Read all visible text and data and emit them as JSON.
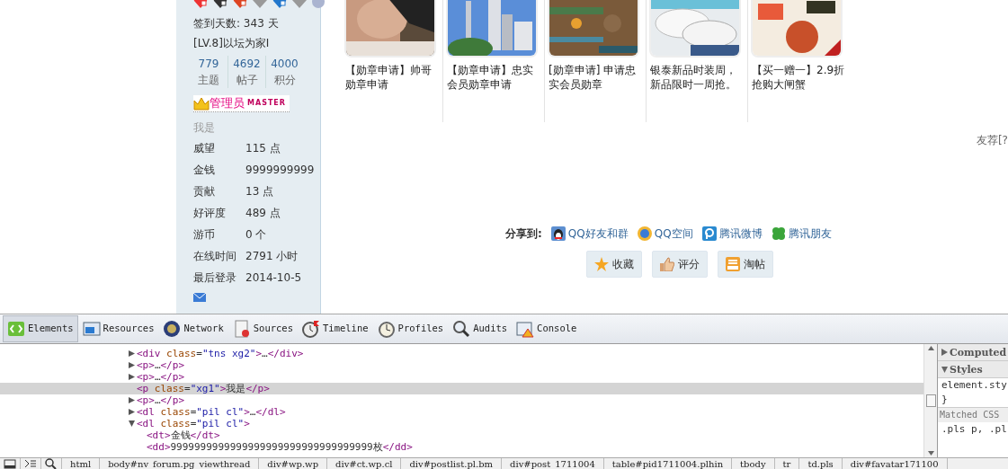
{
  "profile": {
    "checkin": "签到天数: 343 天",
    "level": "[LV.8]以坛为家I",
    "stats": [
      {
        "value": "779",
        "label": "主题"
      },
      {
        "value": "4692",
        "label": "帖子"
      },
      {
        "value": "4000",
        "label": "积分"
      }
    ],
    "group_badge": "管理员",
    "group_tag": "MASTER",
    "custom_title": "我是",
    "fields": [
      {
        "label": "威望",
        "value": "115 点"
      },
      {
        "label": "金钱",
        "value": "9999999999"
      },
      {
        "label": "贡献",
        "value": "13 点"
      },
      {
        "label": "好评度",
        "value": "489 点"
      },
      {
        "label": "游币",
        "value": "0 个"
      },
      {
        "label": "在线时间",
        "value": "2791 小时"
      },
      {
        "label": "最后登录",
        "value": "2014-10-5"
      }
    ]
  },
  "posts": [
    {
      "title": "【勋章申请】帅哥勋章申请"
    },
    {
      "title": "【勋章申请】忠实会员勋章申请"
    },
    {
      "title": "[勋章申请] 申请忠实会员勋章"
    },
    {
      "title": "银泰新品时装周，新品限时一周抢。"
    },
    {
      "title": "【买一赠一】2.9折抢购大闸蟹"
    }
  ],
  "side_note": "友荐[?",
  "share": {
    "label": "分享到:",
    "targets": [
      {
        "kind": "qq",
        "label": "QQ好友和群"
      },
      {
        "kind": "qzone",
        "label": "QQ空间"
      },
      {
        "kind": "weibo",
        "label": "腾讯微博"
      },
      {
        "kind": "pengyou",
        "label": "腾讯朋友"
      }
    ]
  },
  "actions": [
    {
      "kind": "favorite",
      "label": "收藏"
    },
    {
      "kind": "rate",
      "label": "评分"
    },
    {
      "kind": "collect",
      "label": "淘帖"
    }
  ],
  "devtools": {
    "tabs": [
      {
        "kind": "elements",
        "label": "Elements",
        "selected": true
      },
      {
        "kind": "resources",
        "label": "Resources",
        "selected": false
      },
      {
        "kind": "network",
        "label": "Network",
        "selected": false
      },
      {
        "kind": "sources",
        "label": "Sources",
        "selected": false
      },
      {
        "kind": "timeline",
        "label": "Timeline",
        "selected": false
      },
      {
        "kind": "profiles",
        "label": "Profiles",
        "selected": false
      },
      {
        "kind": "audits",
        "label": "Audits",
        "selected": false
      },
      {
        "kind": "console",
        "label": "Console",
        "selected": false
      }
    ],
    "dom_lines": [
      {
        "markup": "<div class=\"tns xg2\">…</div>",
        "expanded": false,
        "selected": false
      },
      {
        "markup": "<p>…</p>",
        "expanded": false,
        "selected": false
      },
      {
        "markup": "<p>…</p>",
        "expanded": false,
        "selected": false
      },
      {
        "markup": "<p class=\"xg1\">我是</p>",
        "selected": true
      },
      {
        "markup": "<p>…</p>",
        "expanded": false,
        "selected": false
      },
      {
        "markup": "<dl class=\"pil cl\">…</dl>",
        "expanded": false,
        "selected": false
      },
      {
        "markup": "<dl class=\"pil cl\">",
        "expanded": true,
        "selected": false,
        "children": [
          {
            "markup": "<dt>金钱</dt>",
            "selected": false
          },
          {
            "markup": "<dd>9999999999999999999999999999999999枚</dd>",
            "selected": false
          }
        ]
      }
    ],
    "styles_sections": [
      {
        "label": "Computed",
        "expanded": false
      },
      {
        "label": "Styles",
        "expanded": true
      }
    ],
    "styles_lines": [
      "element.sty",
      "}"
    ],
    "matched_header": "Matched CSS",
    "matched_line": ".pls p, .pl",
    "breadcrumb": [
      "html",
      "body#nv_forum.pg_viewthread",
      "div#wp.wp",
      "div#ct.wp.cl",
      "div#postlist.pl.bm",
      "div#post_1711004",
      "table#pid1711004.plhin",
      "tbody",
      "tr",
      "td.pls",
      "div#favatar171100"
    ]
  }
}
